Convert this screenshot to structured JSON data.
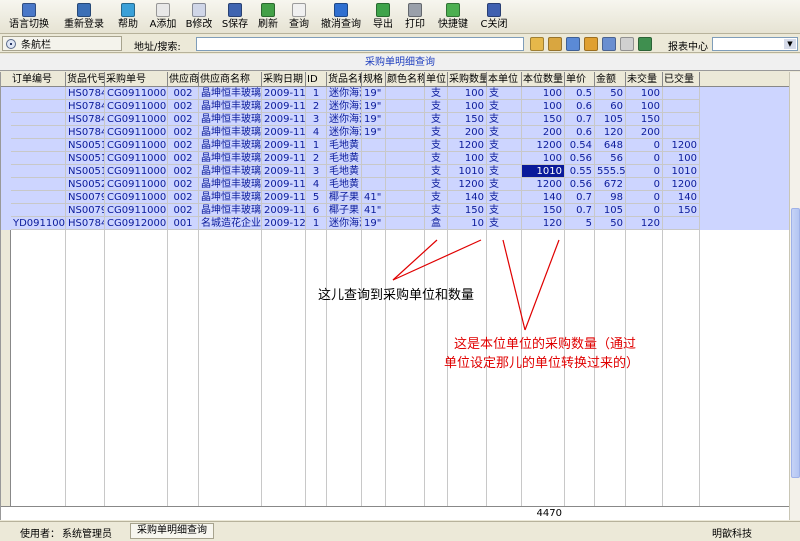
{
  "toolbar": {
    "buttons": [
      {
        "label": "语言切换",
        "icon": "language-icon",
        "color": "#4a78c8"
      },
      {
        "label": "重新登录",
        "icon": "relogin-icon",
        "color": "#3b6fb6"
      },
      {
        "label": "帮助",
        "icon": "help-icon",
        "color": "#3aa0d8"
      },
      {
        "label": "A添加",
        "icon": "add-icon",
        "color": "#e8e8e8"
      },
      {
        "label": "B修改",
        "icon": "edit-icon",
        "color": "#d0d6e8"
      },
      {
        "label": "S保存",
        "icon": "save-icon",
        "color": "#3f64b0"
      },
      {
        "label": "刷新",
        "icon": "refresh-icon",
        "color": "#43a047"
      },
      {
        "label": "查询",
        "icon": "query-icon",
        "color": "#f0f0f0"
      },
      {
        "label": "撤消查询",
        "icon": "cancel-query-icon",
        "color": "#2f6fd0"
      },
      {
        "label": "导出",
        "icon": "export-icon",
        "color": "#3ea34a"
      },
      {
        "label": "打印",
        "icon": "print-icon",
        "color": "#9aa0aa"
      },
      {
        "label": "快捷键",
        "icon": "shortcut-icon",
        "color": "#4caf50"
      },
      {
        "label": "C关闭",
        "icon": "close-icon",
        "color": "#4060b0"
      }
    ]
  },
  "navbar": {
    "tab_label": "条航栏",
    "address_label": "地址/搜索:",
    "address_value": "",
    "icons": [
      {
        "icon": "nav-folder-icon",
        "color": "#e6b84a"
      },
      {
        "icon": "nav-find-icon",
        "color": "#d9a640"
      },
      {
        "icon": "nav-bookmark-icon",
        "color": "#5b8ad6"
      },
      {
        "icon": "nav-pen-icon",
        "color": "#e0a030"
      },
      {
        "icon": "nav-tool-icon",
        "color": "#6a8fd0"
      },
      {
        "icon": "nav-home-icon",
        "color": "#d0d0d0"
      },
      {
        "icon": "nav-globe-icon",
        "color": "#3f8f4f"
      }
    ],
    "report_label": "报表中心",
    "report_value": ""
  },
  "grid": {
    "title": "采购单明细查询",
    "columns": [
      "订单编号",
      "货品代号",
      "采购单号",
      "供应商",
      "供应商名称",
      "采购日期",
      "ID",
      "货品名称",
      "规格",
      "颜色名称",
      "单位",
      "采购数量",
      "本单位",
      "本位数量",
      "单价",
      "金额",
      "未交量",
      "已交量"
    ],
    "rows": [
      [
        "",
        "HS0784-",
        "CG09110001",
        "002",
        "晶坤恒丰玻璃厂",
        "2009-11-24",
        "1",
        "迷你海浮",
        "19\"",
        "",
        "支",
        "100",
        "支",
        "100",
        "0.5",
        "50",
        "100",
        ""
      ],
      [
        "",
        "HS0784-",
        "CG09110001",
        "002",
        "晶坤恒丰玻璃厂",
        "2009-11-24",
        "2",
        "迷你海浮",
        "19\"",
        "",
        "支",
        "100",
        "支",
        "100",
        "0.6",
        "60",
        "100",
        ""
      ],
      [
        "",
        "HS0784-",
        "CG09110001",
        "002",
        "晶坤恒丰玻璃厂",
        "2009-11-24",
        "3",
        "迷你海浮",
        "19\"",
        "",
        "支",
        "150",
        "支",
        "150",
        "0.7",
        "105",
        "150",
        ""
      ],
      [
        "",
        "HS0784-",
        "CG09110001",
        "002",
        "晶坤恒丰玻璃厂",
        "2009-11-24",
        "4",
        "迷你海浮",
        "19\"",
        "",
        "支",
        "200",
        "支",
        "200",
        "0.6",
        "120",
        "200",
        ""
      ],
      [
        "",
        "NS0051-",
        "CG09110002",
        "002",
        "晶坤恒丰玻璃厂",
        "2009-11-24",
        "1",
        "毛地黄",
        "",
        "",
        "支",
        "1200",
        "支",
        "1200",
        "0.54",
        "648",
        "0",
        "1200"
      ],
      [
        "",
        "NS0051-",
        "CG09110002",
        "002",
        "晶坤恒丰玻璃厂",
        "2009-11-24",
        "2",
        "毛地黄",
        "",
        "",
        "支",
        "100",
        "支",
        "100",
        "0.56",
        "56",
        "0",
        "100"
      ],
      [
        "",
        "NS0051-",
        "CG09110002",
        "002",
        "晶坤恒丰玻璃厂",
        "2009-11-24",
        "3",
        "毛地黄",
        "",
        "",
        "支",
        "1010",
        "支",
        "1010",
        "0.55",
        "555.5",
        "0",
        "1010"
      ],
      [
        "",
        "NS0052-",
        "CG09110002",
        "002",
        "晶坤恒丰玻璃厂",
        "2009-11-24",
        "4",
        "毛地黄",
        "",
        "",
        "支",
        "1200",
        "支",
        "1200",
        "0.56",
        "672",
        "0",
        "1200"
      ],
      [
        "",
        "NS0079-",
        "CG09110002",
        "002",
        "晶坤恒丰玻璃厂",
        "2009-11-24",
        "5",
        "椰子果",
        "41\"",
        "",
        "支",
        "140",
        "支",
        "140",
        "0.7",
        "98",
        "0",
        "140"
      ],
      [
        "",
        "NS0079-",
        "CG09110002",
        "002",
        "晶坤恒丰玻璃厂",
        "2009-11-24",
        "6",
        "椰子果",
        "41\"",
        "",
        "支",
        "150",
        "支",
        "150",
        "0.7",
        "105",
        "0",
        "150"
      ],
      [
        "YD09110002",
        "HS0784-",
        "CG09120001",
        "001",
        "名城造花企业有",
        "2009-12-11",
        "1",
        "迷你海浮",
        "19\"",
        "",
        "盒",
        "10",
        "支",
        "120",
        "5",
        "50",
        "120",
        ""
      ]
    ],
    "selected_row": 6,
    "selected_col": 13,
    "total_value": "4470"
  },
  "annotations": {
    "note1": "这儿查询到采购单位和数量",
    "note2_line1": "这是本位单位的采购数量（通过",
    "note2_line2": "单位设定那儿的单位转换过来的）"
  },
  "statusbar": {
    "user_label": "使用者：",
    "user_name": "系统管理员",
    "active_tab": "采购单明细查询",
    "company": "明歆科技"
  }
}
